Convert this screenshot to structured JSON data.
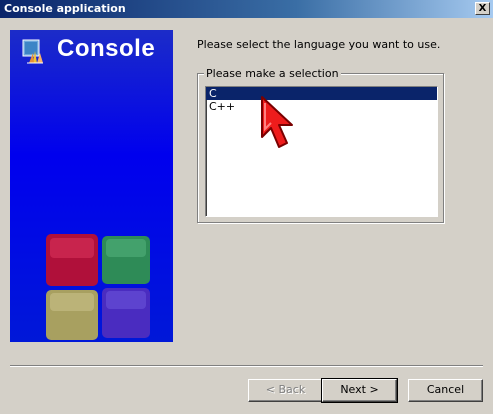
{
  "window": {
    "title": "Console application",
    "close_label": "X"
  },
  "banner": {
    "title": "Console",
    "colors": {
      "background": "#0000ee",
      "cube_red": "#b0103a",
      "cube_green": "#2e8b57",
      "cube_yellow": "#a8a060",
      "cube_purple": "#4a2cc0"
    }
  },
  "main": {
    "instruction": "Please select the language you want to use.",
    "group_label": "Please make a selection",
    "languages": [
      {
        "label": "C",
        "selected": true
      },
      {
        "label": "C++",
        "selected": false
      }
    ],
    "cursor_icon": "red-arrow-pointer-icon"
  },
  "buttons": {
    "back_label": "< Back",
    "next_label": "Next >",
    "cancel_label": "Cancel"
  }
}
